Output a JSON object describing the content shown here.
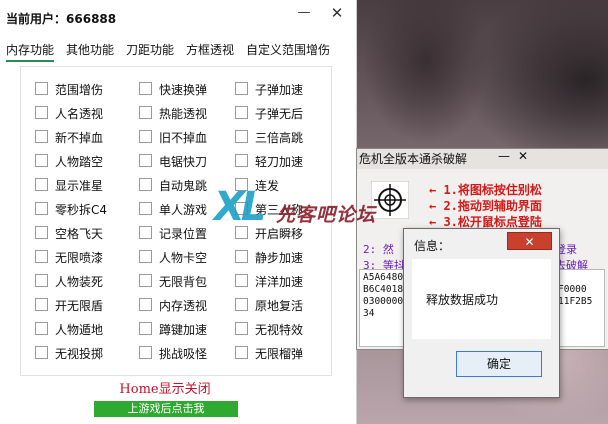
{
  "app": {
    "title_prefix": "当前用户：",
    "user_id": "666888",
    "minimize": "—",
    "close": "✕"
  },
  "tabs": [
    "内存功能",
    "其他功能",
    "刀距功能",
    "方框透视",
    "自定义范围增伤"
  ],
  "checkboxes": [
    [
      "范围增伤",
      "快速换弹",
      "子弹加速"
    ],
    [
      "人名透视",
      "热能透视",
      "子弹无后"
    ],
    [
      "新不掉血",
      "旧不掉血",
      "三倍高跳"
    ],
    [
      "人物踏空",
      "电锯快刀",
      "轻刀加速"
    ],
    [
      "显示准星",
      "自动鬼跳",
      "连发"
    ],
    [
      "零秒拆C4",
      "单人游戏",
      "第三人称"
    ],
    [
      "空格飞天",
      "记录位置",
      "开启瞬移"
    ],
    [
      "无限喷漆",
      "人物卡空",
      "静步加速"
    ],
    [
      "人物装死",
      "无限背包",
      "洋洋加速"
    ],
    [
      "开无限盾",
      "内存透视",
      "原地复活"
    ],
    [
      "人物遁地",
      "蹲键加速",
      "无视特效"
    ],
    [
      "无视投掷",
      "挑战吸怪",
      "无限榴弹"
    ]
  ],
  "footer": {
    "home": "Home显示关闭",
    "start_button": "上游戏后点击我"
  },
  "window2": {
    "title": "危机全版本通杀破解",
    "minimize": "—",
    "close": "✕",
    "instructions": [
      "← 1.将图标按住别松",
      "← 2.拖动到辅助界面",
      "← 3.松开鼠标点登陆"
    ],
    "hint_left": "2: 然\n3: 等抖",
    "hint_right": "登录\n去破解",
    "hex_left": "A5A6480\nB6C4018\n0300000\n34",
    "hex_right": "\nF0000\n11F2B5"
  },
  "watermark": {
    "logo": "XL",
    "text": "先客吧论坛"
  },
  "dialog": {
    "title": "信息：",
    "close": "✕",
    "message": "释放数据成功",
    "ok": "确定"
  },
  "colors": {
    "accent": "#2fa92f",
    "home_text": "#c8102e",
    "instruction_red": "#d41818",
    "dialog_close": "#c8402e"
  }
}
